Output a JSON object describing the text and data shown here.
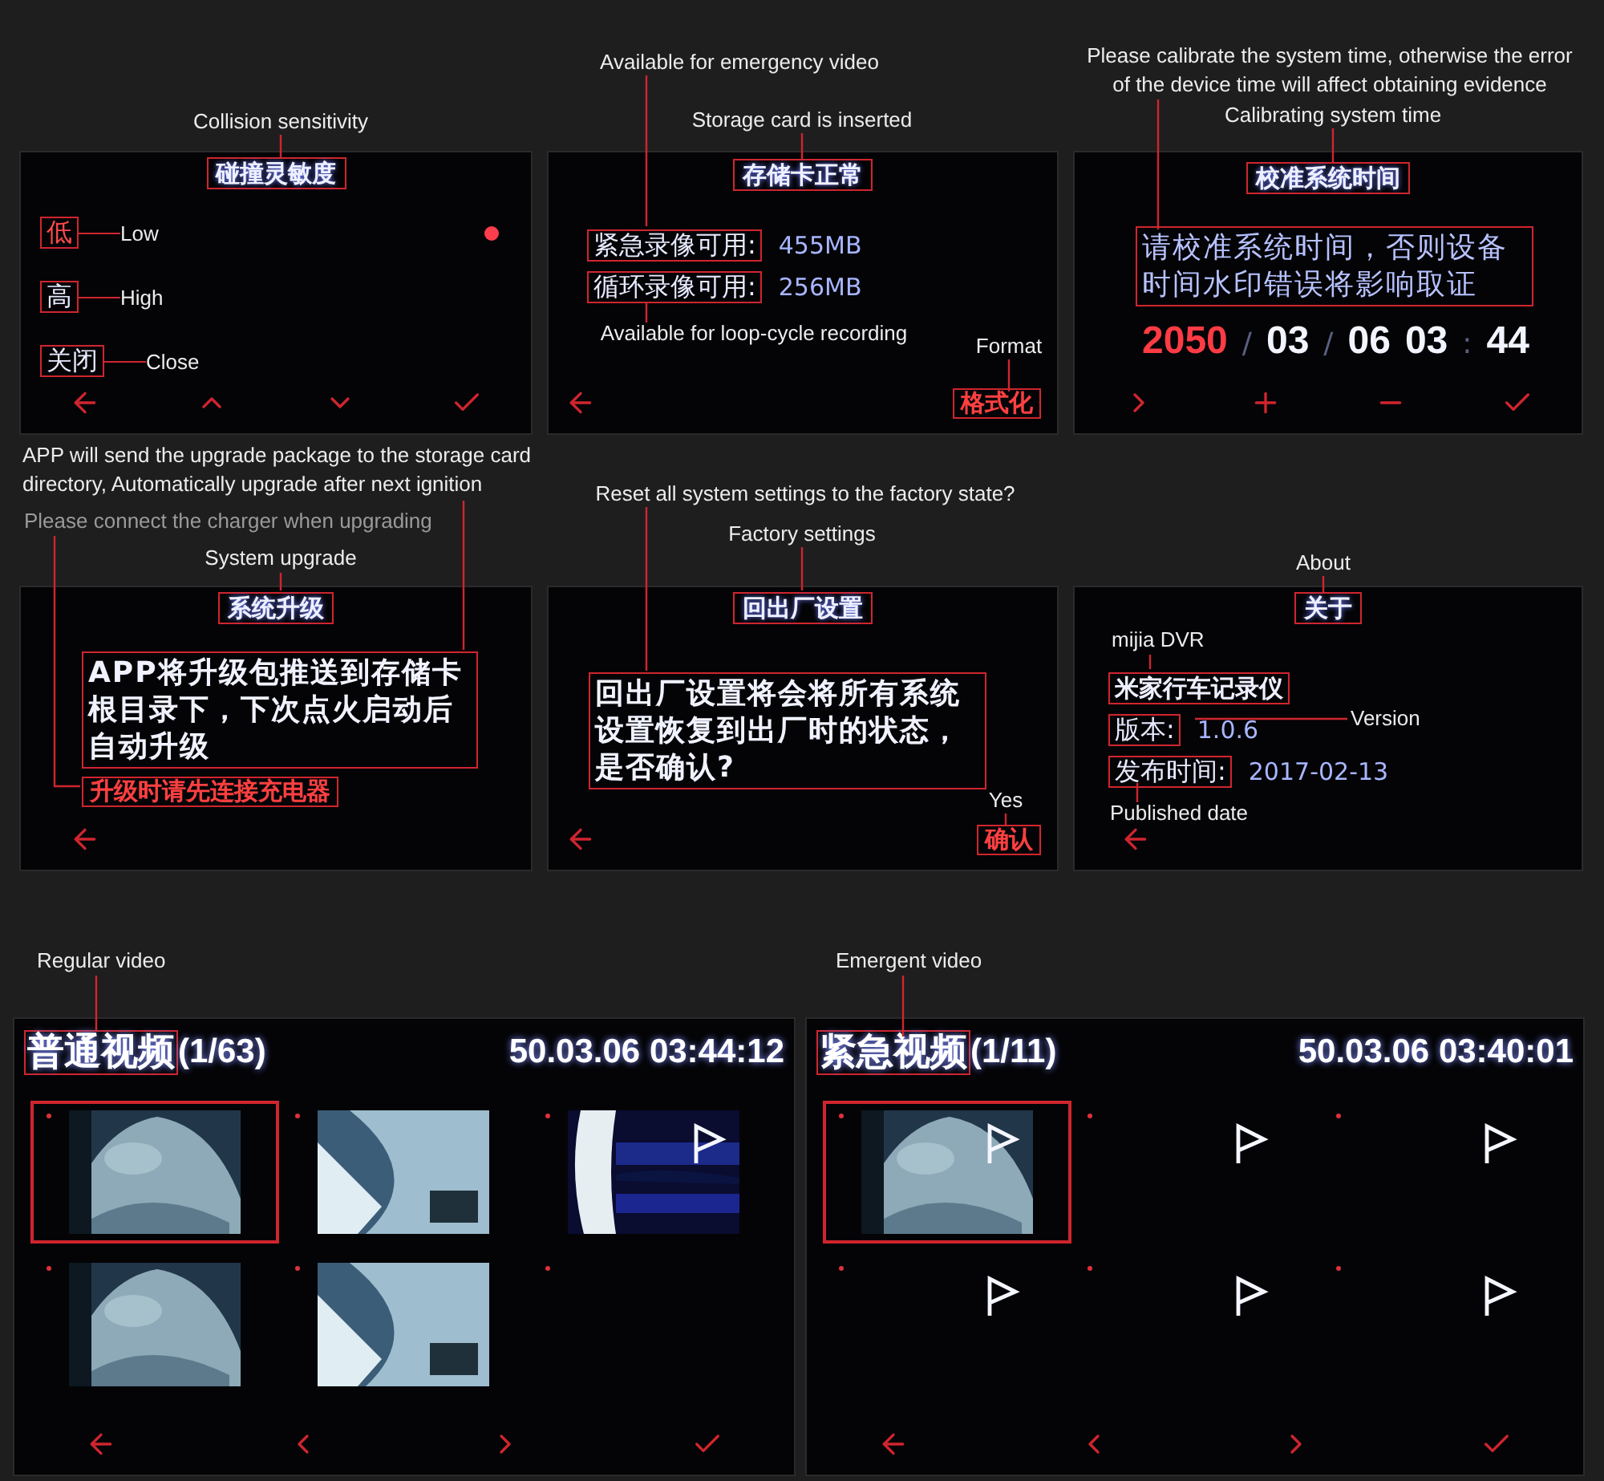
{
  "panels": [
    {
      "kind": "sensitivity",
      "title": "碰撞灵敏度",
      "title_note": "Collision sensitivity",
      "options": [
        {
          "label": "低",
          "note": "Low",
          "selected": true
        },
        {
          "label": "高",
          "note": "High",
          "selected": false
        },
        {
          "label": "关闭",
          "note": "Close",
          "selected": false
        }
      ]
    },
    {
      "kind": "storage",
      "title": "存储卡正常",
      "title_note": "Storage card is inserted",
      "rows": [
        {
          "label": "紧急录像可用:",
          "value": "455MB",
          "note": "Available for emergency video"
        },
        {
          "label": "循环录像可用:",
          "value": "256MB",
          "note": "Available for loop-cycle recording"
        }
      ],
      "action": {
        "label": "格式化",
        "note": "Format"
      }
    },
    {
      "kind": "time",
      "title": "校准系统时间",
      "title_note": "Calibrating system time",
      "message": "请校准系统时间，否则设备时间水印错误将影响取证",
      "message_note": "Please calibrate the system time, otherwise the error of the device time will affect obtaining evidence",
      "fields": [
        {
          "value": "2050",
          "selected": true,
          "sep": "/"
        },
        {
          "value": "03",
          "selected": false,
          "sep": "/"
        },
        {
          "value": "06",
          "selected": false
        },
        {
          "value": "03",
          "selected": false,
          "sep": ":"
        },
        {
          "value": "44",
          "selected": false
        }
      ]
    },
    {
      "kind": "upgrade",
      "title": "系统升级",
      "title_note": "System upgrade",
      "message": "APP将升级包推送到存储卡根目录下，下次点火启动后自动升级",
      "message_note": "APP will send the upgrade package to the storage card directory, Automatically upgrade after next ignition",
      "warning": "升级时请先连接充电器",
      "warning_note": "Please connect the charger when upgrading"
    },
    {
      "kind": "reset",
      "title": "回出厂设置",
      "title_note": "Factory settings",
      "message": "回出厂设置将会将所有系统设置恢复到出厂时的状态，是否确认?",
      "message_note": "Reset all system settings to the factory state?",
      "action": {
        "label": "确认",
        "note": "Yes"
      }
    },
    {
      "kind": "about",
      "title": "关于",
      "title_note": "About",
      "product": "米家行车记录仪",
      "product_note": "mijia DVR",
      "rows": [
        {
          "label": "版本:",
          "value": "1.0.6",
          "note": "Version"
        },
        {
          "label": "发布时间:",
          "value": "2017-02-13",
          "note": "Published date"
        }
      ]
    }
  ],
  "videos": [
    {
      "title": "普通视频",
      "count": "(1/63)",
      "datetime": "50.03.06 03:44:12",
      "title_note": "Regular video",
      "thumbs": [
        {
          "kind": "picture",
          "selected": true,
          "flagged": false
        },
        {
          "kind": "picture",
          "selected": false,
          "flagged": false
        },
        {
          "kind": "picture",
          "selected": false,
          "flagged": true
        },
        {
          "kind": "picture",
          "selected": false,
          "flagged": false
        },
        {
          "kind": "picture",
          "selected": false,
          "flagged": false
        },
        {
          "kind": "empty",
          "selected": false,
          "flagged": false
        }
      ]
    },
    {
      "title": "紧急视频",
      "count": "(1/11)",
      "datetime": "50.03.06 03:40:01",
      "title_note": "Emergent video",
      "thumbs": [
        {
          "kind": "picture",
          "selected": true,
          "flagged": true
        },
        {
          "kind": "empty",
          "selected": false,
          "flagged": true
        },
        {
          "kind": "empty",
          "selected": false,
          "flagged": true
        },
        {
          "kind": "empty",
          "selected": false,
          "flagged": true
        },
        {
          "kind": "empty",
          "selected": false,
          "flagged": true
        },
        {
          "kind": "empty",
          "selected": false,
          "flagged": true
        }
      ]
    }
  ]
}
